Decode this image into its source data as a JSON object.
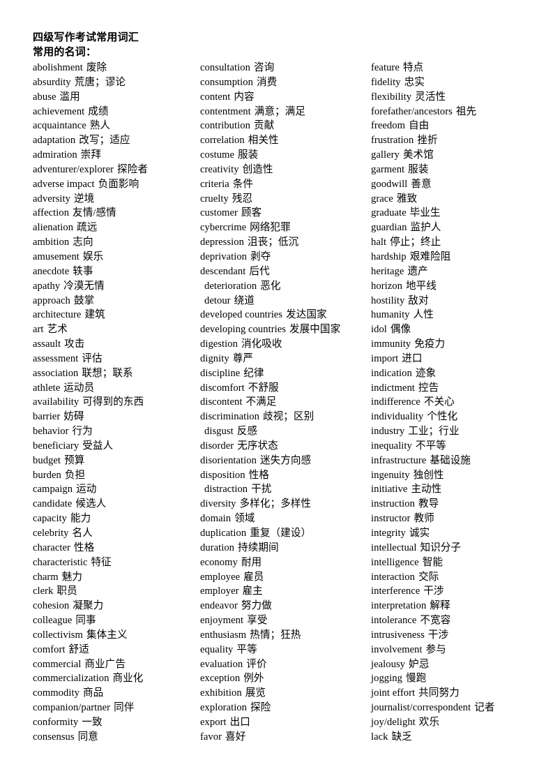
{
  "document": {
    "title": "四级写作考试常用词汇",
    "subtitle": "常用的名词："
  },
  "columns": [
    {
      "id": "column-1",
      "entries": [
        {
          "term": "abolishment",
          "gloss": "废除",
          "indent": false
        },
        {
          "term": "absurdity",
          "gloss": "荒唐；谬论",
          "indent": false
        },
        {
          "term": "abuse",
          "gloss": "滥用",
          "indent": false
        },
        {
          "term": "achievement",
          "gloss": "成绩",
          "indent": false
        },
        {
          "term": "acquaintance",
          "gloss": "熟人",
          "indent": false
        },
        {
          "term": "adaptation",
          "gloss": "改写；适应",
          "indent": false
        },
        {
          "term": "admiration",
          "gloss": "崇拜",
          "indent": false
        },
        {
          "term": "adventurer/explorer",
          "gloss": "探险者",
          "indent": false
        },
        {
          "term": "adverse impact",
          "gloss": "负面影响",
          "indent": false
        },
        {
          "term": "adversity",
          "gloss": "逆境",
          "indent": false
        },
        {
          "term": "affection",
          "gloss": "友情/感情",
          "indent": false
        },
        {
          "term": "alienation",
          "gloss": "疏远",
          "indent": false
        },
        {
          "term": "ambition",
          "gloss": "志向",
          "indent": false
        },
        {
          "term": "amusement",
          "gloss": "娱乐",
          "indent": false
        },
        {
          "term": "anecdote",
          "gloss": "轶事",
          "indent": false
        },
        {
          "term": "apathy",
          "gloss": "冷漠无情",
          "indent": false
        },
        {
          "term": "approach",
          "gloss": "鼓掌",
          "indent": false
        },
        {
          "term": "architecture",
          "gloss": "建筑",
          "indent": false
        },
        {
          "term": "art",
          "gloss": "艺术",
          "indent": false
        },
        {
          "term": "assault",
          "gloss": "攻击",
          "indent": false
        },
        {
          "term": "assessment",
          "gloss": "评估",
          "indent": false
        },
        {
          "term": "association",
          "gloss": "联想；联系",
          "indent": false
        },
        {
          "term": "athlete",
          "gloss": "运动员",
          "indent": false
        },
        {
          "term": "availability",
          "gloss": "可得到的东西",
          "indent": false
        },
        {
          "term": "barrier",
          "gloss": "妨碍",
          "indent": false
        },
        {
          "term": "behavior",
          "gloss": "行为",
          "indent": false
        },
        {
          "term": "beneficiary",
          "gloss": "受益人",
          "indent": false
        },
        {
          "term": "budget",
          "gloss": "预算",
          "indent": false
        },
        {
          "term": "burden",
          "gloss": "负担",
          "indent": false
        },
        {
          "term": "campaign",
          "gloss": "运动",
          "indent": false
        },
        {
          "term": "candidate",
          "gloss": "候选人",
          "indent": false
        },
        {
          "term": "capacity",
          "gloss": "能力",
          "indent": false
        },
        {
          "term": "celebrity",
          "gloss": "名人",
          "indent": false
        },
        {
          "term": "character",
          "gloss": "性格",
          "indent": false
        },
        {
          "term": "characteristic",
          "gloss": "特征",
          "indent": false
        },
        {
          "term": "charm",
          "gloss": "魅力",
          "indent": false
        },
        {
          "term": "clerk",
          "gloss": "职员",
          "indent": false
        },
        {
          "term": "cohesion",
          "gloss": "凝聚力",
          "indent": false
        },
        {
          "term": "colleague",
          "gloss": "同事",
          "indent": false
        },
        {
          "term": "collectivism",
          "gloss": "集体主义",
          "indent": false
        },
        {
          "term": "comfort",
          "gloss": "舒适",
          "indent": false
        },
        {
          "term": "commercial",
          "gloss": "商业广告",
          "indent": false
        },
        {
          "term": "commercialization",
          "gloss": "商业化",
          "indent": false
        },
        {
          "term": "commodity",
          "gloss": "商品",
          "indent": false
        },
        {
          "term": "companion/partner",
          "gloss": "同伴",
          "indent": false
        },
        {
          "term": "conformity",
          "gloss": "一致",
          "indent": false
        },
        {
          "term": "consensus",
          "gloss": "同意",
          "indent": false
        }
      ]
    },
    {
      "id": "column-2",
      "entries": [
        {
          "term": "consultation",
          "gloss": "咨询",
          "indent": false
        },
        {
          "term": "consumption",
          "gloss": "消费",
          "indent": false
        },
        {
          "term": "content",
          "gloss": "内容",
          "indent": false
        },
        {
          "term": "contentment",
          "gloss": "满意；满足",
          "indent": false
        },
        {
          "term": "contribution",
          "gloss": "贡献",
          "indent": false
        },
        {
          "term": "correlation",
          "gloss": "相关性",
          "indent": false
        },
        {
          "term": "costume",
          "gloss": "服装",
          "indent": false
        },
        {
          "term": "creativity",
          "gloss": "创造性",
          "indent": false
        },
        {
          "term": "criteria",
          "gloss": "条件",
          "indent": false
        },
        {
          "term": "cruelty",
          "gloss": "残忍",
          "indent": false
        },
        {
          "term": "customer",
          "gloss": "顾客",
          "indent": false
        },
        {
          "term": "cybercrime",
          "gloss": "网络犯罪",
          "indent": false
        },
        {
          "term": "depression",
          "gloss": "沮丧；低沉",
          "indent": false
        },
        {
          "term": "deprivation",
          "gloss": "剥夺",
          "indent": false
        },
        {
          "term": "descendant",
          "gloss": "后代",
          "indent": false
        },
        {
          "term": "deterioration",
          "gloss": "恶化",
          "indent": true
        },
        {
          "term": "detour",
          "gloss": "绕道",
          "indent": true
        },
        {
          "term": "developed countries",
          "gloss": "发达国家",
          "indent": false
        },
        {
          "term": "developing countries",
          "gloss": "发展中国家",
          "indent": false
        },
        {
          "term": "digestion",
          "gloss": "消化吸收",
          "indent": false
        },
        {
          "term": "dignity",
          "gloss": "尊严",
          "indent": false
        },
        {
          "term": "discipline",
          "gloss": "纪律",
          "indent": false
        },
        {
          "term": "discomfort",
          "gloss": "不舒服",
          "indent": false
        },
        {
          "term": "discontent",
          "gloss": "不满足",
          "indent": false
        },
        {
          "term": "discrimination",
          "gloss": "歧视；区别",
          "indent": false
        },
        {
          "term": "disgust",
          "gloss": "反感",
          "indent": true
        },
        {
          "term": "disorder",
          "gloss": "无序状态",
          "indent": false
        },
        {
          "term": "disorientation",
          "gloss": "迷失方向感",
          "indent": false
        },
        {
          "term": "disposition",
          "gloss": "性格",
          "indent": false
        },
        {
          "term": "distraction",
          "gloss": "干扰",
          "indent": true
        },
        {
          "term": "diversity",
          "gloss": "多样化；多样性",
          "indent": false
        },
        {
          "term": "domain",
          "gloss": "领域",
          "indent": false
        },
        {
          "term": "duplication",
          "gloss": "重复（建设）",
          "indent": false
        },
        {
          "term": "duration",
          "gloss": "持续期间",
          "indent": false
        },
        {
          "term": "economy",
          "gloss": "耐用",
          "indent": false
        },
        {
          "term": "employee",
          "gloss": "雇员",
          "indent": false
        },
        {
          "term": "employer",
          "gloss": "雇主",
          "indent": false
        },
        {
          "term": "endeavor",
          "gloss": "努力做",
          "indent": false
        },
        {
          "term": "enjoyment",
          "gloss": "享受",
          "indent": false
        },
        {
          "term": "enthusiasm",
          "gloss": "热情；狂热",
          "indent": false
        },
        {
          "term": "equality",
          "gloss": "平等",
          "indent": false
        },
        {
          "term": "evaluation",
          "gloss": "评价",
          "indent": false
        },
        {
          "term": "exception",
          "gloss": "例外",
          "indent": false
        },
        {
          "term": "exhibition",
          "gloss": "展览",
          "indent": false
        },
        {
          "term": "exploration",
          "gloss": "探险",
          "indent": false
        },
        {
          "term": "export",
          "gloss": "出口",
          "indent": false
        },
        {
          "term": "favor",
          "gloss": "喜好",
          "indent": false
        }
      ]
    },
    {
      "id": "column-3",
      "entries": [
        {
          "term": "feature",
          "gloss": "特点",
          "indent": false
        },
        {
          "term": "fidelity",
          "gloss": "忠实",
          "indent": false
        },
        {
          "term": "flexibility",
          "gloss": "灵活性",
          "indent": false
        },
        {
          "term": "forefather/ancestors",
          "gloss": "祖先",
          "indent": false
        },
        {
          "term": "freedom",
          "gloss": "自由",
          "indent": false
        },
        {
          "term": "frustration",
          "gloss": "挫折",
          "indent": false
        },
        {
          "term": "gallery",
          "gloss": "美术馆",
          "indent": false
        },
        {
          "term": "garment",
          "gloss": "服装",
          "indent": false
        },
        {
          "term": "goodwill",
          "gloss": "善意",
          "indent": false
        },
        {
          "term": "grace",
          "gloss": "雅致",
          "indent": false
        },
        {
          "term": "graduate",
          "gloss": "毕业生",
          "indent": false
        },
        {
          "term": "guardian",
          "gloss": "监护人",
          "indent": false
        },
        {
          "term": "halt",
          "gloss": "停止；终止",
          "indent": false
        },
        {
          "term": "hardship",
          "gloss": "艰难险阻",
          "indent": false
        },
        {
          "term": "heritage",
          "gloss": "遗产",
          "indent": false
        },
        {
          "term": "horizon",
          "gloss": "地平线",
          "indent": false
        },
        {
          "term": "hostility",
          "gloss": "敌对",
          "indent": false
        },
        {
          "term": "humanity",
          "gloss": "人性",
          "indent": false
        },
        {
          "term": "idol",
          "gloss": "偶像",
          "indent": false
        },
        {
          "term": "immunity",
          "gloss": "免疫力",
          "indent": false
        },
        {
          "term": "import",
          "gloss": "进口",
          "indent": false
        },
        {
          "term": "indication",
          "gloss": "迹象",
          "indent": false
        },
        {
          "term": "indictment",
          "gloss": "控告",
          "indent": false
        },
        {
          "term": "indifference",
          "gloss": "不关心",
          "indent": false
        },
        {
          "term": "individuality",
          "gloss": "个性化",
          "indent": false
        },
        {
          "term": "industry",
          "gloss": "工业；行业",
          "indent": false
        },
        {
          "term": "inequality",
          "gloss": "不平等",
          "indent": false
        },
        {
          "term": "infrastructure",
          "gloss": "基础设施",
          "indent": false
        },
        {
          "term": "ingenuity",
          "gloss": "独创性",
          "indent": false
        },
        {
          "term": "initiative",
          "gloss": "主动性",
          "indent": false
        },
        {
          "term": "instruction",
          "gloss": "教导",
          "indent": false
        },
        {
          "term": "instructor",
          "gloss": "教师",
          "indent": false
        },
        {
          "term": "integrity",
          "gloss": "诚实",
          "indent": false
        },
        {
          "term": "intellectual",
          "gloss": "知识分子",
          "indent": false
        },
        {
          "term": "intelligence",
          "gloss": "智能",
          "indent": false
        },
        {
          "term": "interaction",
          "gloss": "交际",
          "indent": false
        },
        {
          "term": "interference",
          "gloss": "干涉",
          "indent": false
        },
        {
          "term": "interpretation",
          "gloss": "解释",
          "indent": false
        },
        {
          "term": "intolerance",
          "gloss": "不宽容",
          "indent": false
        },
        {
          "term": "intrusiveness",
          "gloss": "干涉",
          "indent": false
        },
        {
          "term": "involvement",
          "gloss": "参与",
          "indent": false
        },
        {
          "term": "jealousy",
          "gloss": "妒忌",
          "indent": false
        },
        {
          "term": "jogging",
          "gloss": "慢跑",
          "indent": false
        },
        {
          "term": "joint effort",
          "gloss": "共同努力",
          "indent": false
        },
        {
          "term": "journalist/correspondent",
          "gloss": "记者",
          "indent": false
        },
        {
          "term": "joy/delight",
          "gloss": "欢乐",
          "indent": false
        },
        {
          "term": "lack",
          "gloss": "缺乏",
          "indent": false
        }
      ]
    }
  ]
}
